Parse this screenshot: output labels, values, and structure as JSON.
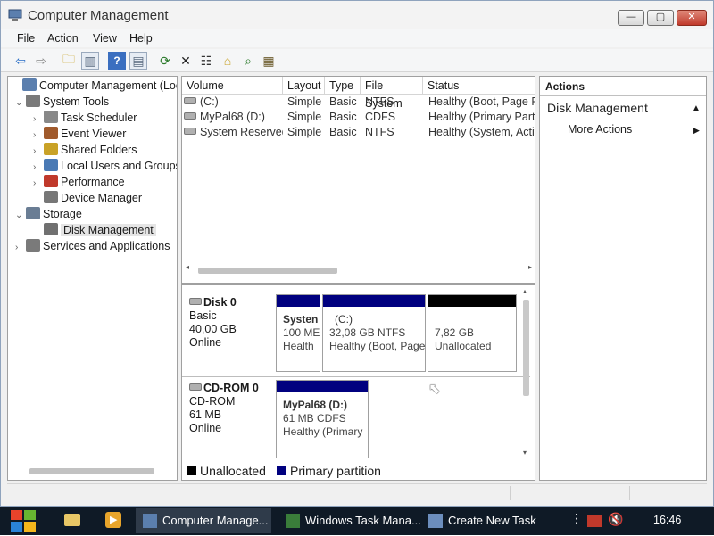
{
  "window": {
    "title": "Computer Management",
    "min_label": "—",
    "max_label": "▢",
    "close_label": "✕"
  },
  "menu": [
    "File",
    "Action",
    "View",
    "Help"
  ],
  "toolbar": [
    {
      "name": "back-icon",
      "glyph": "⇦",
      "color": "#2a6ec6"
    },
    {
      "name": "forward-icon",
      "glyph": "⇨",
      "color": "#8a8a8a"
    },
    {
      "name": "up-folder-icon",
      "glyph": "🗀",
      "color": "#c9a227"
    },
    {
      "name": "show-hide-tree-icon",
      "glyph": "▥",
      "color": "#5b6b80"
    },
    {
      "name": "help-icon",
      "glyph": "?",
      "color": "#ffffff"
    },
    {
      "name": "show-hide-action-pane-icon",
      "glyph": "▤",
      "color": "#5b6b80"
    },
    {
      "name": "refresh-icon",
      "glyph": "⟳",
      "color": "#2b7a2b"
    },
    {
      "name": "delete-icon",
      "glyph": "✕",
      "color": "#222222"
    },
    {
      "name": "properties-icon",
      "glyph": "☷",
      "color": "#333333"
    },
    {
      "name": "open-icon",
      "glyph": "⌂",
      "color": "#c9a227"
    },
    {
      "name": "search-icon",
      "glyph": "⌕",
      "color": "#2b7a2b"
    },
    {
      "name": "rescan-icon",
      "glyph": "▦",
      "color": "#6b5a2b"
    }
  ],
  "tree": [
    {
      "label": "Computer Management (Local",
      "chev": "",
      "indent": 0,
      "icon": "computer-icon",
      "color": "#5b7fae"
    },
    {
      "label": "System Tools",
      "chev": "⌄",
      "indent": 1,
      "icon": "tools-icon",
      "color": "#7a7a7a"
    },
    {
      "label": "Task Scheduler",
      "chev": "›",
      "indent": 2,
      "icon": "clock-icon",
      "color": "#888888"
    },
    {
      "label": "Event Viewer",
      "chev": "›",
      "indent": 2,
      "icon": "event-viewer-icon",
      "color": "#a05a2c"
    },
    {
      "label": "Shared Folders",
      "chev": "›",
      "indent": 2,
      "icon": "shared-folder-icon",
      "color": "#c9a227"
    },
    {
      "label": "Local Users and Groups",
      "chev": "›",
      "indent": 2,
      "icon": "users-icon",
      "color": "#4a7ab5"
    },
    {
      "label": "Performance",
      "chev": "›",
      "indent": 2,
      "icon": "performance-icon",
      "color": "#c0392b"
    },
    {
      "label": "Device Manager",
      "chev": "",
      "indent": 2,
      "icon": "device-manager-icon",
      "color": "#777777"
    },
    {
      "label": "Storage",
      "chev": "⌄",
      "indent": 1,
      "icon": "storage-icon",
      "color": "#6a7d94"
    },
    {
      "label": "Disk Management",
      "chev": "",
      "indent": 2,
      "icon": "disk-icon",
      "color": "#707070",
      "selected": true
    },
    {
      "label": "Services and Applications",
      "chev": "›",
      "indent": 1,
      "icon": "services-icon",
      "color": "#7a7a7a"
    }
  ],
  "columns": [
    "Volume",
    "Layout",
    "Type",
    "File System",
    "Status"
  ],
  "volumes": [
    {
      "volume": "(C:)",
      "layout": "Simple",
      "type": "Basic",
      "fs": "NTFS",
      "status": "Healthy (Boot, Page Fi"
    },
    {
      "volume": "MyPal68 (D:)",
      "layout": "Simple",
      "type": "Basic",
      "fs": "CDFS",
      "status": "Healthy (Primary Partit"
    },
    {
      "volume": "System Reserved",
      "layout": "Simple",
      "type": "Basic",
      "fs": "NTFS",
      "status": "Healthy (System, Activ"
    }
  ],
  "disks": [
    {
      "name": "Disk 0",
      "kind": "Basic",
      "size": "40,00 GB",
      "state": "Online",
      "partitions": [
        {
          "title": "Systen",
          "line2": "100 ME",
          "line3": "Health",
          "bar": "primary"
        },
        {
          "title": "(C:)",
          "line2": "32,08 GB NTFS",
          "line3": "Healthy (Boot, Page",
          "bar": "primary"
        },
        {
          "title": "",
          "line2": "7,82 GB",
          "line3": "Unallocated",
          "bar": "unallocated"
        }
      ]
    },
    {
      "name": "CD-ROM 0",
      "kind": "CD-ROM",
      "size": "61 MB",
      "state": "Online",
      "partitions": [
        {
          "title": "MyPal68  (D:)",
          "line2": "61 MB CDFS",
          "line3": "Healthy (Primary",
          "bar": "primary"
        }
      ]
    }
  ],
  "legend": [
    {
      "label": "Unallocated",
      "color": "#000000"
    },
    {
      "label": "Primary partition",
      "color": "#00007f"
    }
  ],
  "actions": {
    "header": "Actions",
    "section": "Disk Management",
    "section_icon": "▲",
    "more": "More Actions",
    "more_icon": "▶"
  },
  "colors": {
    "primary_bar": "#00007f",
    "unallocated_bar": "#000000",
    "taskbar_bg": "#0f1a26"
  },
  "taskbar": {
    "start_icon": "windows-start-icon",
    "tasks": [
      "Computer Manage...",
      "Windows Task Mana...",
      "Create New Task"
    ],
    "clock": "16:46"
  }
}
